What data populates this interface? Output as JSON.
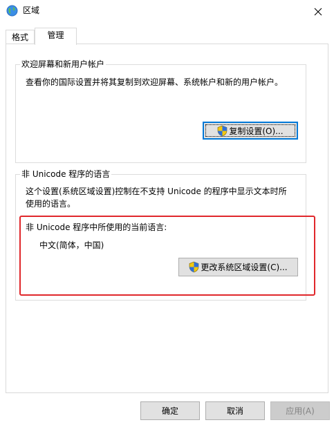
{
  "window": {
    "title": "区域",
    "icon": "globe-icon"
  },
  "tabs": [
    {
      "label": "格式",
      "active": false
    },
    {
      "label": "管理",
      "active": true
    }
  ],
  "welcome": {
    "legend": "欢迎屏幕和新用户帐户",
    "description": "查看你的国际设置并将其复制到欢迎屏幕、系统帐户和新的用户帐户。",
    "copy_button": "复制设置(O)..."
  },
  "non_unicode": {
    "legend": "非 Unicode 程序的语言",
    "description": "这个设置(系统区域设置)控制在不支持 Unicode 的程序中显示文本时所使用的语言。",
    "current_label": "非 Unicode 程序中所使用的当前语言:",
    "current_value": "中文(简体，中国)",
    "change_button": "更改系统区域设置(C)..."
  },
  "footer": {
    "ok": "确定",
    "cancel": "取消",
    "apply": "应用(A)"
  },
  "colors": {
    "highlight": "#e0262a",
    "focus": "#0078d7",
    "button": "#e1e1e1"
  }
}
